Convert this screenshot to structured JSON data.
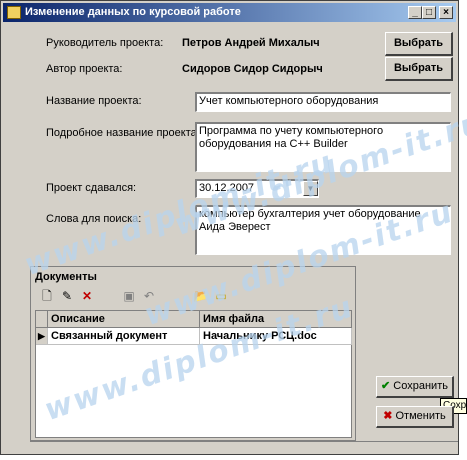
{
  "window": {
    "title": "Изменение данных по курсовой работе"
  },
  "fields": {
    "manager_label": "Руководитель проекта:",
    "manager_value": "Петров Андрей Михалыч",
    "author_label": "Автор проекта:",
    "author_value": "Сидоров Сидор Сидорыч",
    "select_button": "Выбрать",
    "name_label": "Название проекта:",
    "name_value": "Учет компьютерного оборудования",
    "fullname_label": "Подробное название проекта:",
    "fullname_value": "Программа по учету компьютерного оборудования на C++ Builder",
    "date_label": "Проект сдавался:",
    "date_value": "30.12.2007",
    "keywords_label": "Слова для поиска:",
    "keywords_value": "компьютер бухгалтерия учет оборудование Аида Эверест"
  },
  "documents": {
    "title": "Документы",
    "columns": [
      "Описание",
      "Имя файла"
    ],
    "rows": [
      {
        "desc": "Связанный документ",
        "file": "Начальнику РСЦ.doc"
      }
    ]
  },
  "actions": {
    "save": "Сохранить",
    "cancel": "Отменить",
    "tooltip": "Сохра"
  },
  "watermark": "www.diplom-it.ru"
}
